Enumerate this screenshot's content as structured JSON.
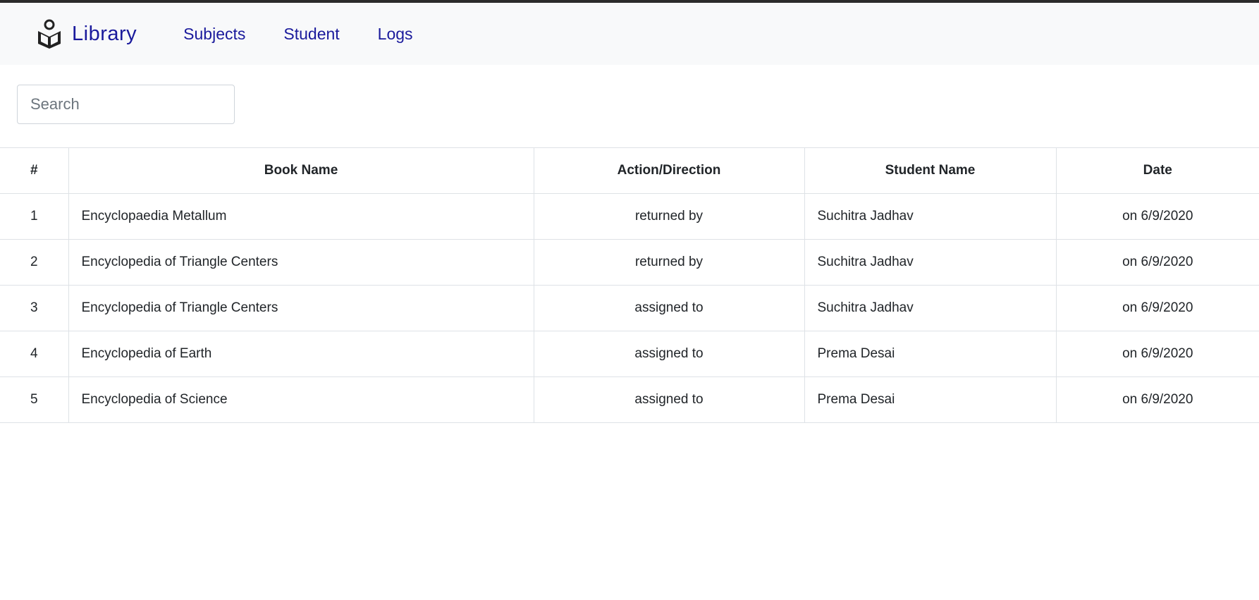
{
  "navbar": {
    "brand": "Library",
    "links": [
      "Subjects",
      "Student",
      "Logs"
    ]
  },
  "search": {
    "placeholder": "Search",
    "value": ""
  },
  "table": {
    "headers": [
      "#",
      "Book Name",
      "Action/Direction",
      "Student Name",
      "Date"
    ],
    "rows": [
      {
        "num": "1",
        "book": "Encyclopaedia Metallum",
        "action": "returned by",
        "student": "Suchitra Jadhav",
        "date": "on 6/9/2020"
      },
      {
        "num": "2",
        "book": "Encyclopedia of Triangle Centers",
        "action": "returned by",
        "student": "Suchitra Jadhav",
        "date": "on 6/9/2020"
      },
      {
        "num": "3",
        "book": "Encyclopedia of Triangle Centers",
        "action": "assigned to",
        "student": "Suchitra Jadhav",
        "date": "on 6/9/2020"
      },
      {
        "num": "4",
        "book": "Encyclopedia of Earth",
        "action": "assigned to",
        "student": "Prema Desai",
        "date": "on 6/9/2020"
      },
      {
        "num": "5",
        "book": "Encyclopedia of Science",
        "action": "assigned to",
        "student": "Prema Desai",
        "date": "on 6/9/2020"
      }
    ]
  },
  "icons": {
    "brand_icon": "reader-book-icon"
  },
  "colors": {
    "brand": "#1a1a9c",
    "navbar_bg": "#f8f9fa",
    "border": "#dee2e6"
  }
}
